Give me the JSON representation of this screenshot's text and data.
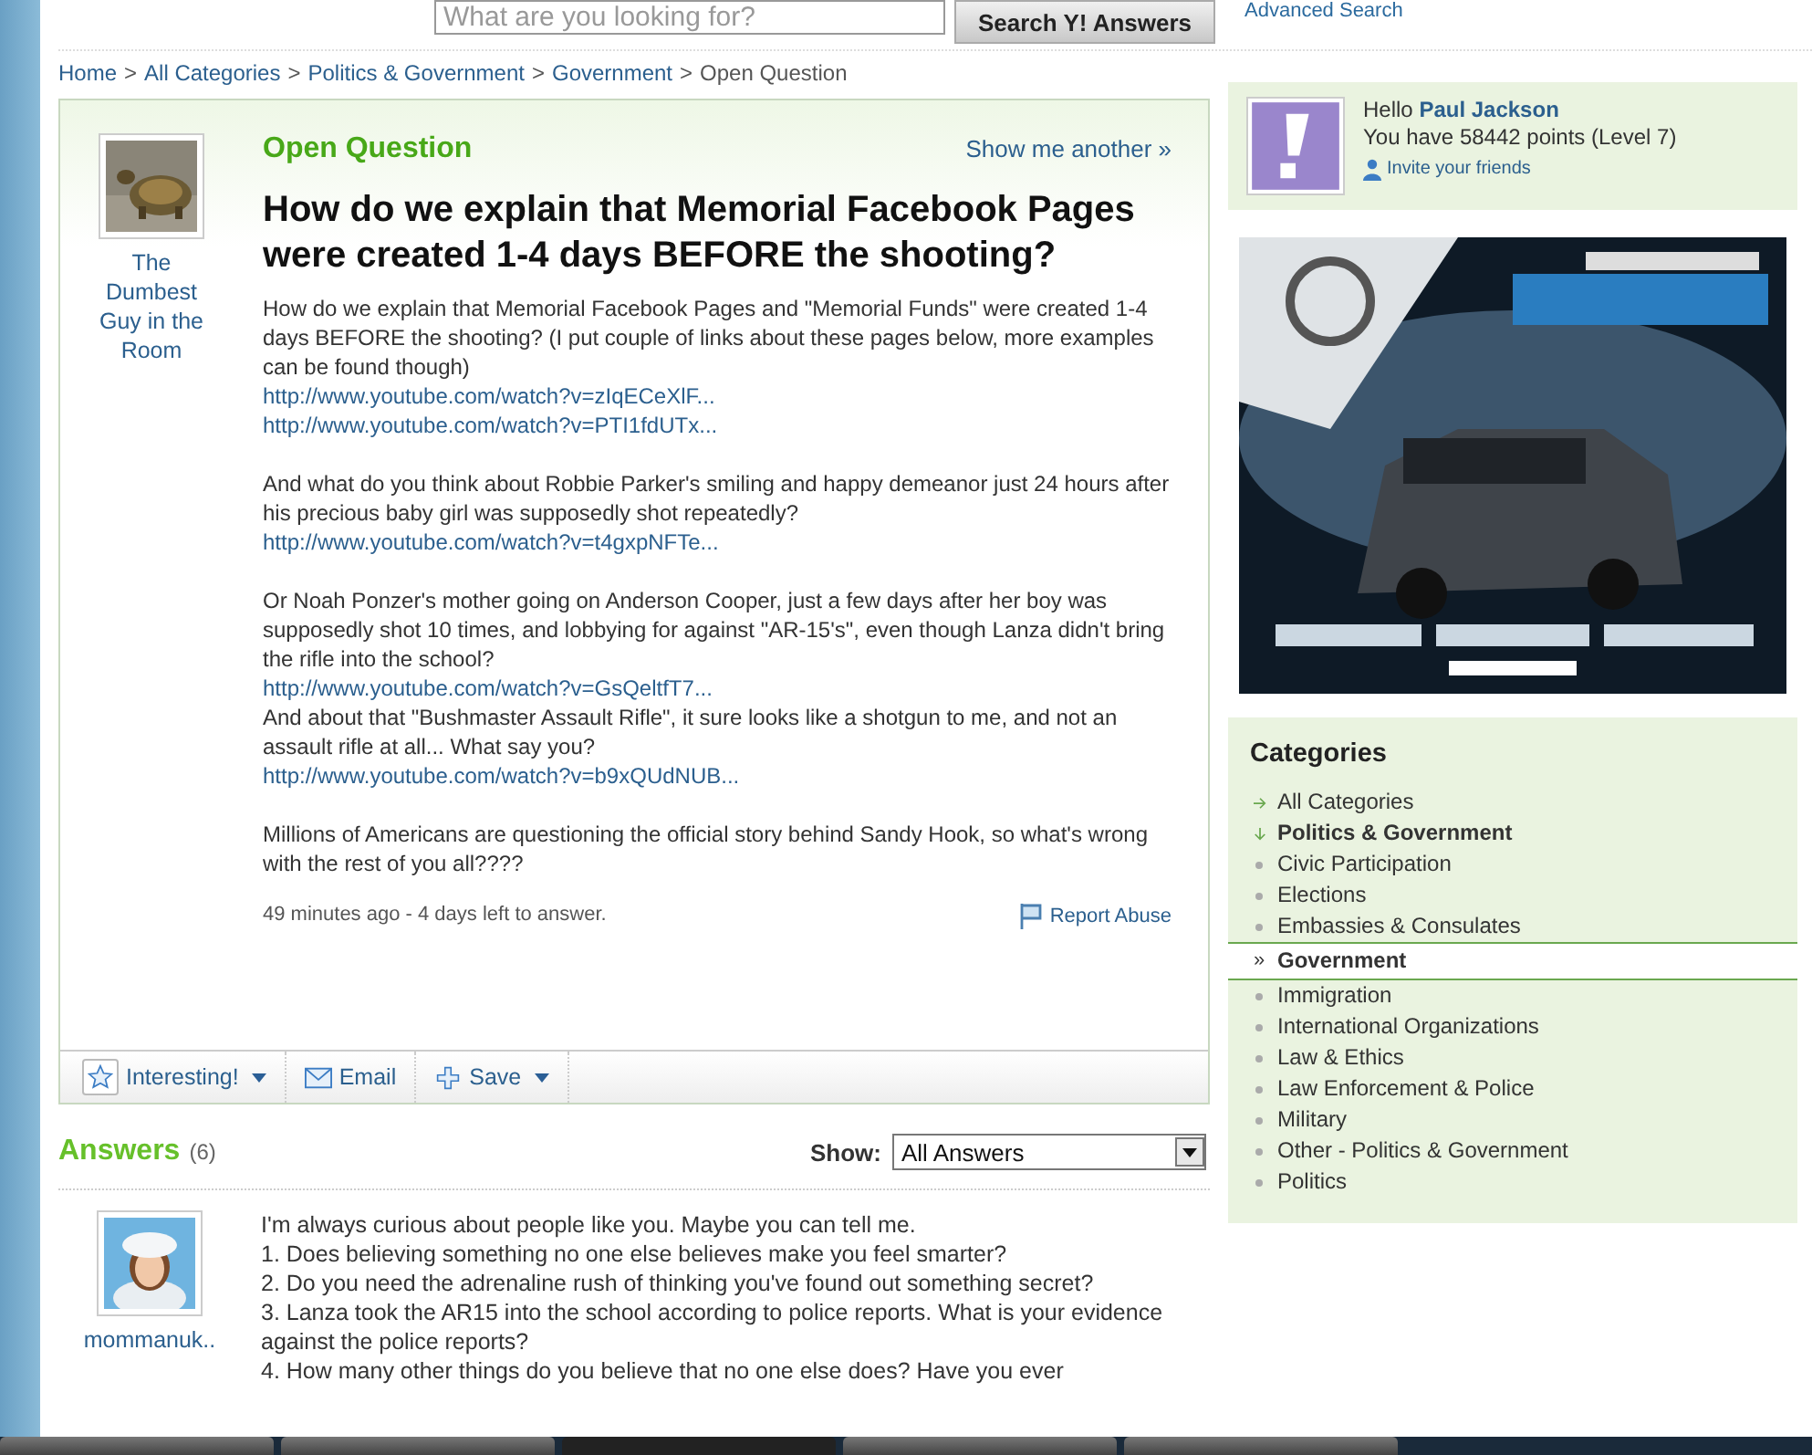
{
  "search": {
    "placeholder": "What are you looking for?",
    "button": "Search Y! Answers",
    "advanced": "Advanced Search"
  },
  "breadcrumb": [
    {
      "text": "Home",
      "kind": "link"
    },
    {
      "text": ">",
      "kind": "separator"
    },
    {
      "text": "All Categories",
      "kind": "link"
    },
    {
      "text": ">",
      "kind": "separator"
    },
    {
      "text": "Politics & Government",
      "kind": "link"
    },
    {
      "text": ">",
      "kind": "separator"
    },
    {
      "text": "Government",
      "kind": "link"
    },
    {
      "text": ">",
      "kind": "separator"
    },
    {
      "text": "Open Question",
      "kind": "current"
    }
  ],
  "question": {
    "status": "Open Question",
    "show_another": "Show me another »",
    "asker": "The Dumbest Guy in the Room",
    "title": "How do we explain that Memorial Facebook Pages were created 1-4 days BEFORE the shooting?",
    "paragraphs": [
      [
        {
          "kind": "text",
          "text": "How do we explain that Memorial Facebook Pages and \"Memorial Funds\" were created 1-4 days BEFORE the shooting? (I put couple of links about these pages below, more examples can be found though)"
        },
        {
          "kind": "link",
          "text": "http://www.youtube.com/watch?v=zIqECeXlF..."
        },
        {
          "kind": "link",
          "text": "http://www.youtube.com/watch?v=PTI1fdUTx..."
        }
      ],
      [
        {
          "kind": "text",
          "text": "And what do you think about Robbie Parker's smiling and happy demeanor just 24 hours after his precious baby girl was supposedly shot repeatedly?"
        },
        {
          "kind": "link",
          "text": "http://www.youtube.com/watch?v=t4gxpNFTe..."
        }
      ],
      [
        {
          "kind": "text",
          "text": "Or Noah Ponzer's mother going on Anderson Cooper, just a few days after her boy was supposedly shot 10 times, and lobbying for against \"AR-15's\", even though Lanza didn't bring the rifle into the school?"
        },
        {
          "kind": "link",
          "text": "http://www.youtube.com/watch?v=GsQeltfT7..."
        },
        {
          "kind": "text",
          "text": "And about that \"Bushmaster Assault Rifle\", it sure looks like a shotgun to me, and not an assault rifle at all... What say you?"
        },
        {
          "kind": "link",
          "text": "http://www.youtube.com/watch?v=b9xQUdNUB..."
        }
      ],
      [
        {
          "kind": "text",
          "text": "Millions of Americans are questioning the official story behind Sandy Hook, so what's wrong with the rest of you all????"
        }
      ]
    ],
    "meta": "49 minutes ago - 4 days left to answer.",
    "report": "Report Abuse",
    "actions": [
      {
        "kind": "interesting",
        "label": "Interesting!",
        "menu": true
      },
      {
        "kind": "email",
        "label": "Email",
        "menu": false
      },
      {
        "kind": "save",
        "label": "Save",
        "menu": true
      }
    ]
  },
  "answers": {
    "title": "Answers",
    "count": "(6)",
    "show_label": "Show:",
    "show_value": "All Answers",
    "items": [
      {
        "user": "mommanuk..",
        "lines": [
          "I'm always curious about people like you. Maybe you can tell me.",
          "1. Does believing something no one else believes make you feel smarter?",
          "2. Do you need the adrenaline rush of thinking you've found out something secret?",
          "3. Lanza took the AR15 into the school according to police reports. What is your evidence against the police reports?",
          "4. How many other things do you believe that no one else does? Have you ever"
        ]
      }
    ]
  },
  "user": {
    "greeting": "Hello",
    "name": "Paul Jackson",
    "points": "You have 58442 points (Level 7)",
    "invite": "Invite your friends"
  },
  "categories": {
    "title": "Categories",
    "items": [
      {
        "kind": "up",
        "text": "All Categories",
        "selected": false
      },
      {
        "kind": "parent",
        "text": "Politics & Government",
        "selected": false
      },
      {
        "kind": "child",
        "text": "Civic Participation",
        "selected": false
      },
      {
        "kind": "child",
        "text": "Elections",
        "selected": false
      },
      {
        "kind": "child",
        "text": "Embassies & Consulates",
        "selected": false
      },
      {
        "kind": "child",
        "text": "Government",
        "selected": true,
        "marker": "»"
      },
      {
        "kind": "child",
        "text": "Immigration",
        "selected": false
      },
      {
        "kind": "child",
        "text": "International Organizations",
        "selected": false
      },
      {
        "kind": "child",
        "text": "Law & Ethics",
        "selected": false
      },
      {
        "kind": "child",
        "text": "Law Enforcement & Police",
        "selected": false
      },
      {
        "kind": "child",
        "text": "Military",
        "selected": false
      },
      {
        "kind": "child",
        "text": "Other - Politics & Government",
        "selected": false
      },
      {
        "kind": "child",
        "text": "Politics",
        "selected": false
      }
    ]
  }
}
